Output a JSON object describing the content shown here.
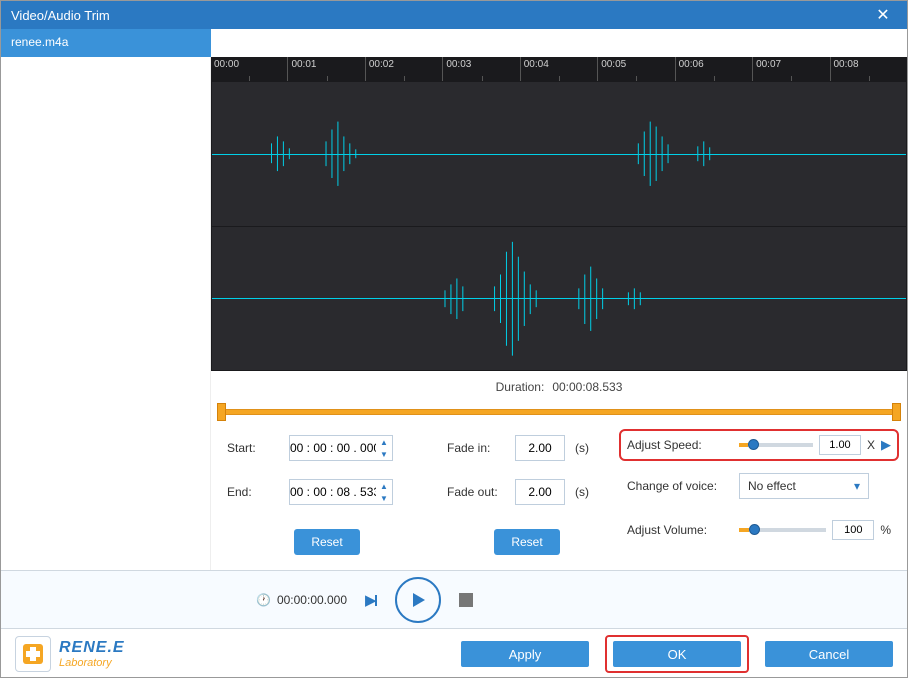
{
  "window": {
    "title": "Video/Audio Trim"
  },
  "file": {
    "name": "renee.m4a"
  },
  "ruler": {
    "ticks": [
      "00:00",
      "00:01",
      "00:02",
      "00:03",
      "00:04",
      "00:05",
      "00:06",
      "00:07",
      "00:08"
    ]
  },
  "duration": {
    "label": "Duration:",
    "value": "00:00:08.533"
  },
  "trim": {
    "start_label": "Start:",
    "start_value": "00 : 00 : 00 . 000",
    "end_label": "End:",
    "end_value": "00 : 00 : 08 . 533",
    "reset_label": "Reset"
  },
  "fade": {
    "in_label": "Fade in:",
    "in_value": "2.00",
    "out_label": "Fade out:",
    "out_value": "2.00",
    "unit": "(s)",
    "reset_label": "Reset"
  },
  "speed": {
    "label": "Adjust Speed:",
    "value": "1.00",
    "unit": "X",
    "slider_percent": 12
  },
  "voice": {
    "label": "Change of voice:",
    "value": "No effect"
  },
  "volume": {
    "label": "Adjust Volume:",
    "value": "100",
    "unit": "%",
    "slider_percent": 12
  },
  "player": {
    "time": "00:00:00.000"
  },
  "footer": {
    "apply": "Apply",
    "ok": "OK",
    "cancel": "Cancel",
    "brand_top": "RENE.E",
    "brand_bottom": "Laboratory"
  }
}
